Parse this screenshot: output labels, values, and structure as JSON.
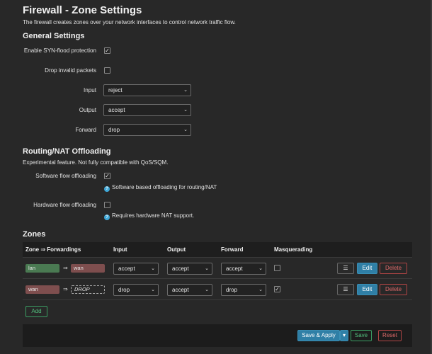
{
  "page": {
    "title": "Firewall - Zone Settings",
    "description": "The firewall creates zones over your network interfaces to control network traffic flow."
  },
  "general": {
    "heading": "General Settings",
    "syn_flood": {
      "label": "Enable SYN-flood protection",
      "checked": true
    },
    "drop_invalid": {
      "label": "Drop invalid packets",
      "checked": false
    },
    "input": {
      "label": "Input",
      "value": "reject"
    },
    "output": {
      "label": "Output",
      "value": "accept"
    },
    "forward": {
      "label": "Forward",
      "value": "drop"
    }
  },
  "offloading": {
    "heading": "Routing/NAT Offloading",
    "description": "Experimental feature. Not fully compatible with QoS/SQM.",
    "software": {
      "label": "Software flow offloading",
      "checked": true,
      "hint": "Software based offloading for routing/NAT"
    },
    "hardware": {
      "label": "Hardware flow offloading",
      "checked": false,
      "hint": "Requires hardware NAT support."
    }
  },
  "zones": {
    "heading": "Zones",
    "columns": {
      "zone": "Zone ⇒ Forwardings",
      "input": "Input",
      "output": "Output",
      "forward": "Forward",
      "masq": "Masquerading"
    },
    "rows": [
      {
        "zone": "lan",
        "zone_color": "#4a7a52",
        "arrow": "⇒",
        "target": "wan",
        "target_color": "#7e4e4e",
        "input": "accept",
        "output": "accept",
        "forward": "accept",
        "masq": false
      },
      {
        "zone": "wan",
        "zone_color": "#7e4e4e",
        "arrow": "⇒",
        "target": "DROP",
        "target_color": "",
        "input": "drop",
        "output": "accept",
        "forward": "drop",
        "masq": true
      }
    ],
    "menu_icon": "☰",
    "edit_label": "Edit",
    "delete_label": "Delete",
    "add_label": "Add"
  },
  "footer": {
    "save_apply": "Save & Apply",
    "save_apply_caret": "▾",
    "save": "Save",
    "reset": "Reset"
  },
  "icons": {
    "help": "?",
    "check": "✓",
    "caret": "⌄"
  }
}
